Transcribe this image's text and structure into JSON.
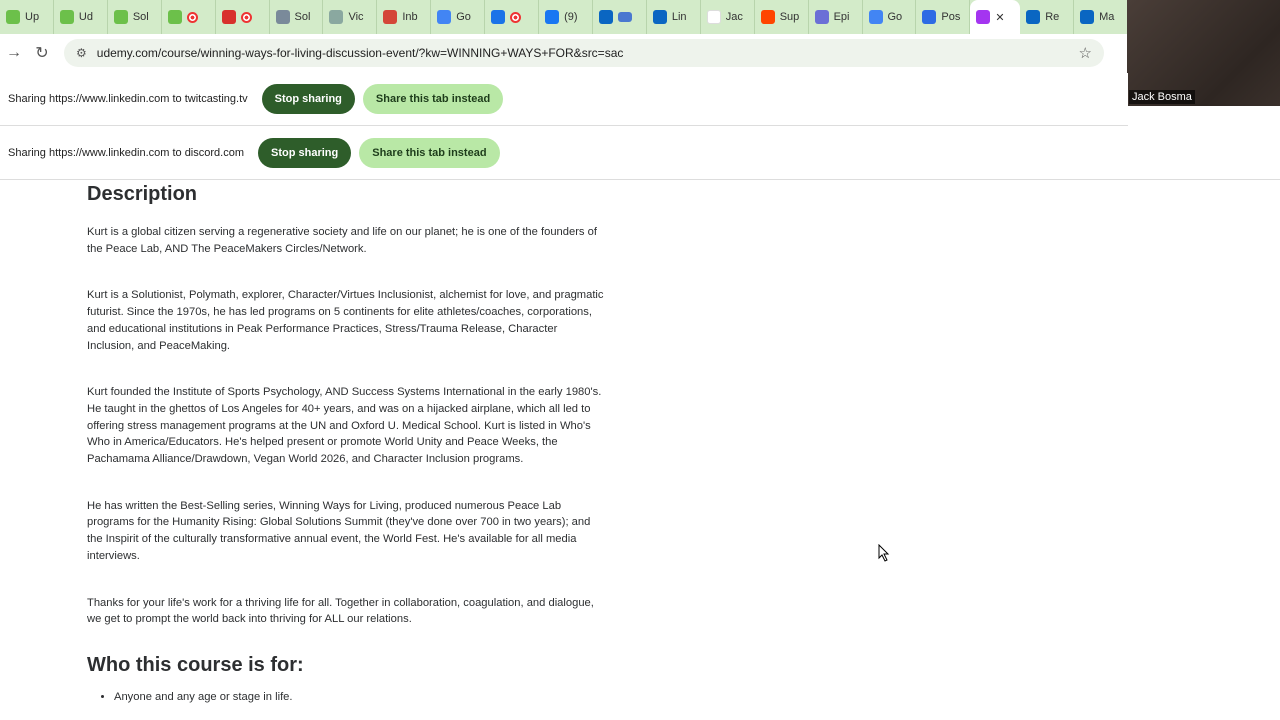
{
  "tabs": [
    {
      "icon": "rumble-icon",
      "color": "#6cc04a",
      "label": "Up"
    },
    {
      "icon": "rumble-icon",
      "color": "#6cc04a",
      "label": "Ud"
    },
    {
      "icon": "rumble-icon",
      "color": "#6cc04a",
      "label": "Sol"
    },
    {
      "icon": "m-logo-icon",
      "color": "#6cc04a",
      "label": "",
      "rec": true
    },
    {
      "icon": "calendar-169-icon",
      "color": "#d8302c",
      "label": "",
      "rec": true
    },
    {
      "icon": "sol-logo-icon",
      "color": "#7a8a9a",
      "label": "Sol"
    },
    {
      "icon": "chatgpt-icon",
      "color": "#8aa8a0",
      "label": "Vic"
    },
    {
      "icon": "gmail-icon",
      "color": "#d44638",
      "label": "Inb"
    },
    {
      "icon": "google-calendar-icon",
      "color": "#4285f4",
      "label": "Go"
    },
    {
      "icon": "circle-arrow-icon",
      "color": "#1a73e8",
      "label": "",
      "rec": true
    },
    {
      "icon": "facebook-icon",
      "color": "#1877f2",
      "label": "(9)"
    },
    {
      "icon": "linkedin-icon",
      "color": "#0a66c2",
      "label": "",
      "screen": true
    },
    {
      "icon": "linkedin-icon",
      "color": "#0a66c2",
      "label": "Lin"
    },
    {
      "icon": "blank-page-icon",
      "color": "#ffffff",
      "label": "Jac"
    },
    {
      "icon": "reddit-icon",
      "color": "#ff4500",
      "label": "Sup"
    },
    {
      "icon": "podcast-icon",
      "color": "#6b6fd6",
      "label": "Epi"
    },
    {
      "icon": "google-calendar-icon",
      "color": "#4285f4",
      "label": "Go"
    },
    {
      "icon": "zoho-icon",
      "color": "#2d6be4",
      "label": "Pos"
    },
    {
      "icon": "udemy-icon",
      "color": "#a435f0",
      "label": "",
      "active": true
    },
    {
      "icon": "linkedin-icon",
      "color": "#0a66c2",
      "label": "Re"
    },
    {
      "icon": "linkedin-icon",
      "color": "#0a66c2",
      "label": "Ma"
    }
  ],
  "url": "udemy.com/course/winning-ways-for-living-discussion-event/?kw=WINNING+WAYS+FOR&src=sac",
  "video": {
    "name": "Jack Bosma"
  },
  "share_bars": [
    {
      "text": "Sharing https://www.linkedin.com to twitcasting.tv",
      "stop": "Stop sharing",
      "switch": "Share this tab instead"
    },
    {
      "text": "Sharing https://www.linkedin.com to discord.com",
      "stop": "Stop sharing",
      "switch": "Share this tab instead"
    }
  ],
  "description": {
    "heading": "Description",
    "paragraphs": [
      "Kurt is a global citizen serving a regenerative society and life on our planet; he is one of the founders of the Peace Lab, AND The PeaceMakers Circles/Network.",
      "Kurt is a Solutionist, Polymath, explorer, Character/Virtues Inclusionist, alchemist for love, and pragmatic futurist. Since the 1970s, he has led programs on 5 continents for elite athletes/coaches, corporations, and educational institutions in Peak Performance Practices, Stress/Trauma Release, Character Inclusion, and PeaceMaking.",
      "Kurt founded the Institute of Sports Psychology, AND Success Systems International in the early 1980's. He taught in the ghettos of Los Angeles for 40+ years, and was on a hijacked airplane, which all led to offering stress management programs at the UN and Oxford U. Medical School. Kurt is listed in Who's Who in America/Educators. He's helped present or promote World Unity and Peace Weeks, the Pachamama Alliance/Drawdown, Vegan World 2026, and Character Inclusion programs.",
      "He has written the Best-Selling series, Winning Ways for Living, produced numerous Peace Lab programs for the Humanity Rising: Global Solutions Summit (they've done over 700 in two years); and the Inspirit of the culturally transformative annual event, the World Fest. He's available for all media interviews.",
      "Thanks for your life's work for a thriving life for all. Together in collaboration, coagulation, and dialogue, we get to prompt the world back into thriving for ALL our relations."
    ]
  },
  "audience": {
    "heading": "Who this course is for:",
    "items": [
      "Anyone and any age or stage in life."
    ]
  }
}
